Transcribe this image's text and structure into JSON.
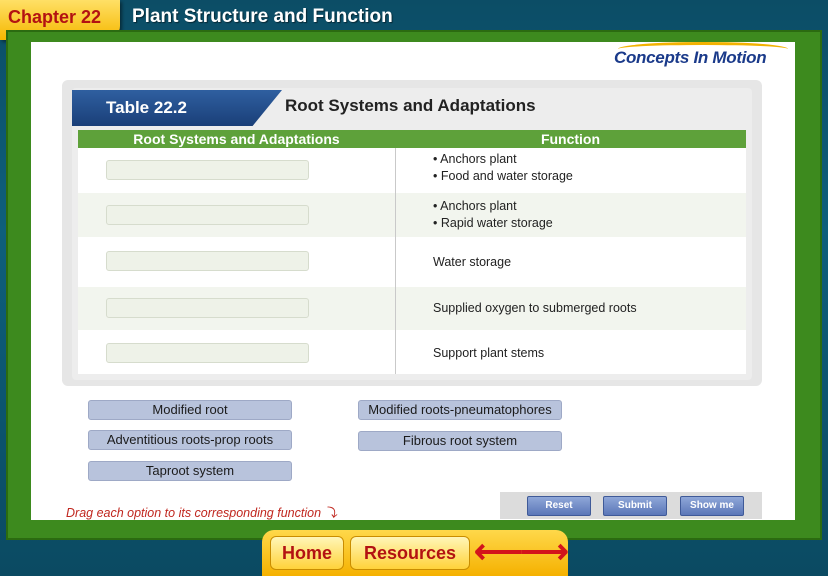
{
  "header": {
    "chapter": "Chapter 22",
    "title": "Plant Structure and Function"
  },
  "logo": {
    "text": "Concepts In Motion"
  },
  "table": {
    "badge": "Table 22.2",
    "heading": "Root Systems and Adaptations",
    "col_left": "Root Systems and Adaptations",
    "col_right": "Function",
    "rows": [
      {
        "functions": [
          "Anchors plant",
          "Food and water storage"
        ]
      },
      {
        "functions": [
          "Anchors plant",
          "Rapid water storage"
        ]
      },
      {
        "functions": [
          "Water storage"
        ]
      },
      {
        "functions": [
          "Supplied oxygen to submerged roots"
        ]
      },
      {
        "functions": [
          "Support plant stems"
        ]
      }
    ]
  },
  "options": [
    "Modified root",
    "Adventitious roots-prop roots",
    "Taproot system",
    "Modified roots-pneumatophores",
    "Fibrous root system"
  ],
  "instructions": "Drag each option to its corresponding function",
  "controls": {
    "reset": "Reset",
    "submit": "Submit",
    "show_me": "Show me"
  },
  "nav": {
    "home": "Home",
    "resources": "Resources",
    "back": "back-arrow-icon",
    "forward": "forward-arrow-icon"
  },
  "colors": {
    "frame": "#3d8a1e",
    "header_green": "#5ea13a",
    "badge_blue": "#1a3f78",
    "nav_yellow": "#f5b100",
    "accent_red": "#b31212"
  }
}
